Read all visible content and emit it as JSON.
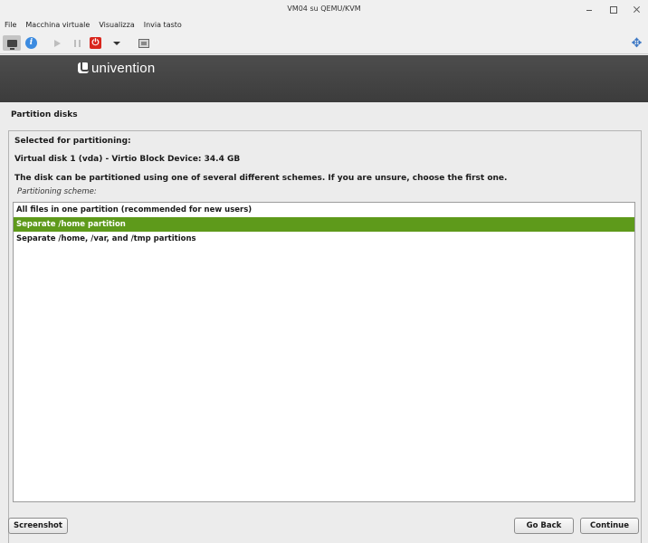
{
  "window": {
    "title": "VM04 su QEMU/KVM"
  },
  "menu": [
    "File",
    "Macchina virtuale",
    "Visualizza",
    "Invia tasto"
  ],
  "toolbar": {
    "icons": [
      "console-icon",
      "info-icon",
      "play-icon",
      "pause-icon",
      "power-icon",
      "dropdown-icon",
      "snapshot-icon",
      "fullscreen-icon"
    ],
    "power_color": "#d9261c",
    "info_color": "#3c8be0"
  },
  "installer": {
    "logo": "univention",
    "page_title": "Partition disks",
    "selected_label": "Selected for partitioning:",
    "disk": "Virtual disk 1 (vda) - Virtio Block Device: 34.4 GB",
    "description": "The disk can be partitioned using one of several different schemes. If you are unsure, choose the first one.",
    "scheme_label": "Partitioning scheme:",
    "options": [
      {
        "label": "All files in one partition (recommended for new users)",
        "selected": false
      },
      {
        "label": "Separate /home partition",
        "selected": true
      },
      {
        "label": "Separate /home, /var, and /tmp partitions",
        "selected": false
      }
    ],
    "selection_color": "#5e9a1b",
    "buttons": {
      "screenshot": "Screenshot",
      "back": "Go Back",
      "continue": "Continue"
    }
  }
}
